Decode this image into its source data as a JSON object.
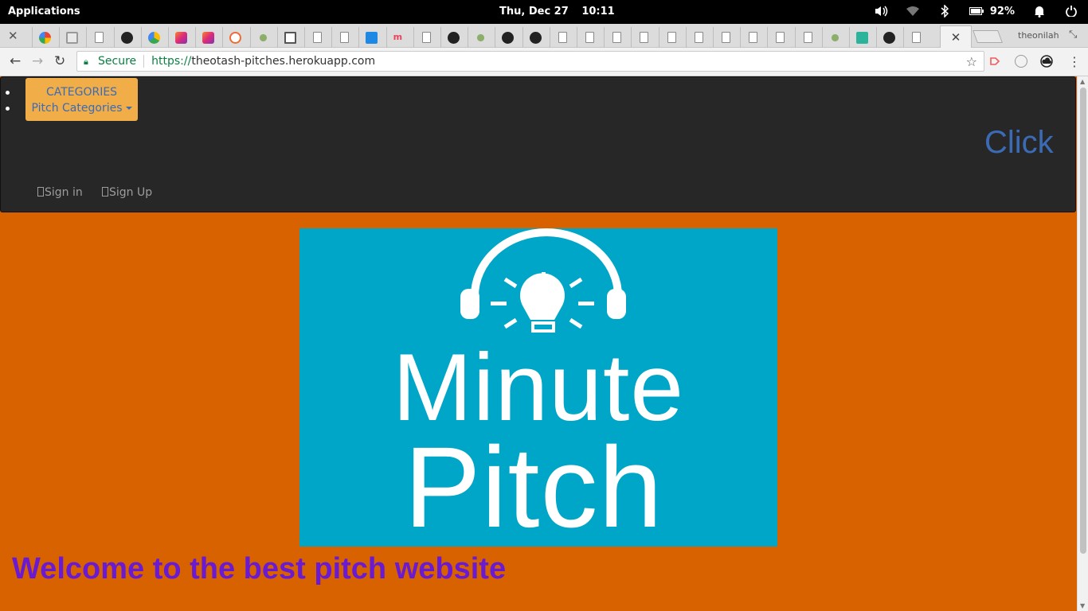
{
  "os_bar": {
    "apps_label": "Applications",
    "date": "Thu, Dec 27",
    "time": "10:11",
    "battery_pct": "92%"
  },
  "browser": {
    "tab_favicons": [
      "google-icon",
      "gmail-icon",
      "page-icon",
      "github-icon",
      "pinwheel-icon",
      "instagram-icon",
      "instagram-icon",
      "orange-icon",
      "tree-icon",
      "book-icon",
      "page-icon",
      "page-icon",
      "x-icon",
      "mm-icon",
      "page-icon",
      "github-icon",
      "tree-icon",
      "github-icon",
      "github-icon",
      "page-icon",
      "page-icon",
      "page-icon",
      "page-icon",
      "page-icon",
      "page-icon",
      "page-icon",
      "page-icon",
      "page-icon",
      "page-icon",
      "tree-icon",
      "d-icon",
      "github-icon",
      "page-icon"
    ],
    "profile_name": "theonilah",
    "secure_label": "Secure",
    "url_protocol": "https://",
    "url_host": "theotash-pitches.herokuapp.com"
  },
  "navbar": {
    "categories_label": "CATEGORIES",
    "pitch_categories_label": "Pitch Categories",
    "click_label": "Click",
    "sign_in": "Sign in",
    "sign_up": "Sign Up"
  },
  "logo": {
    "line1": "Minute",
    "line2": "Pitch"
  },
  "main": {
    "welcome": "Welcome to the best pitch website"
  },
  "colors": {
    "page_bg": "#d86200",
    "navbar_bg": "#272727",
    "dropdown_bg": "#f1ad47",
    "link_blue": "#3b6bb5",
    "logo_bg": "#00a6c8",
    "welcome_purple": "#6a1bd1"
  }
}
